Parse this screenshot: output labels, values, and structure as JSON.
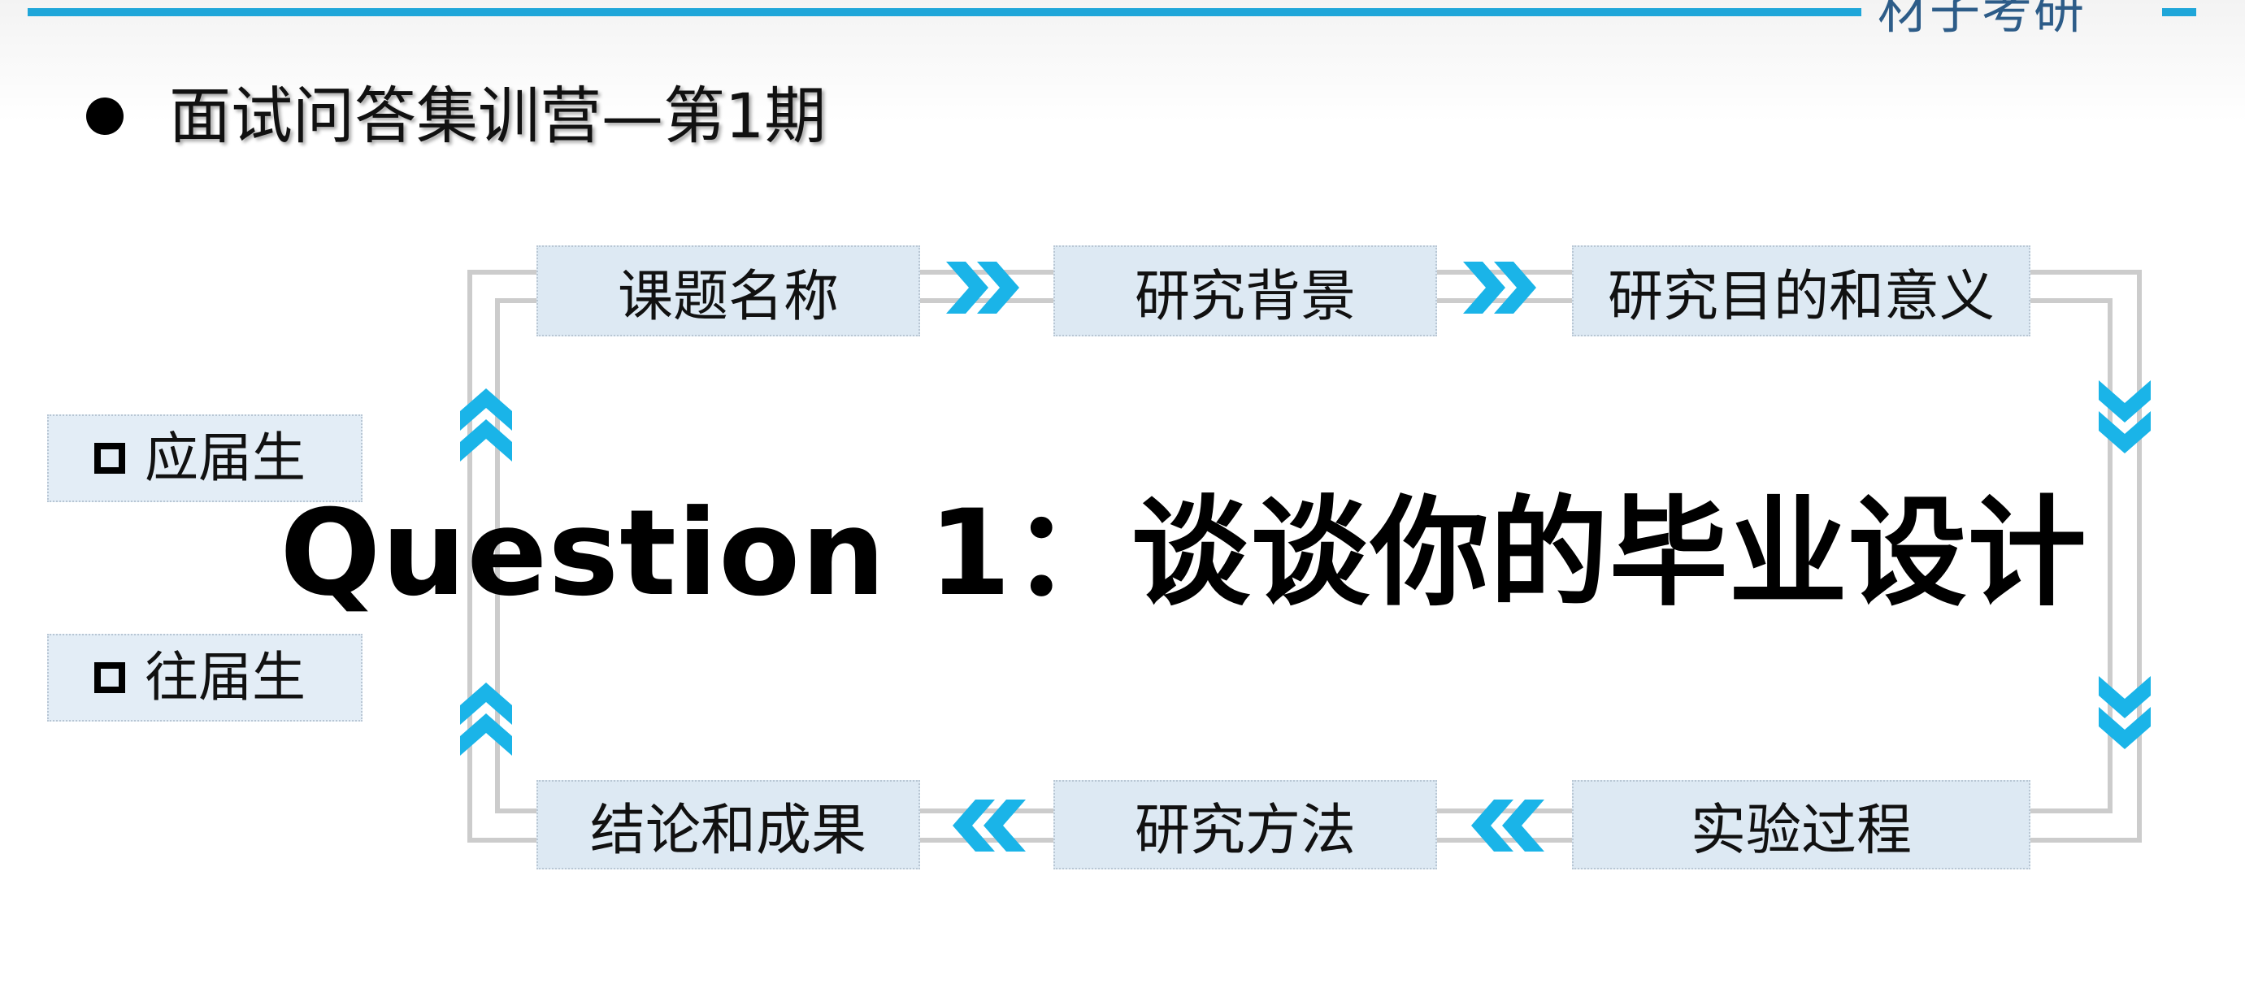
{
  "header": {
    "brand": "材子考研",
    "title": "面试问答集训营—第1期",
    "accent_color": "#1fa6d9"
  },
  "options": [
    {
      "label": "应届生"
    },
    {
      "label": "往届生"
    }
  ],
  "question": {
    "text": "Question 1：谈谈你的毕业设计"
  },
  "flow": {
    "top_steps": [
      {
        "label": "课题名称"
      },
      {
        "label": "研究背景"
      },
      {
        "label": "研究目的和意义"
      }
    ],
    "bottom_steps": [
      {
        "label": "结论和成果"
      },
      {
        "label": "研究方法"
      },
      {
        "label": "实验过程"
      }
    ],
    "box_color": "#dde9f3",
    "line_color": "#cccccc",
    "arrow_color": "#1ab4e8"
  }
}
